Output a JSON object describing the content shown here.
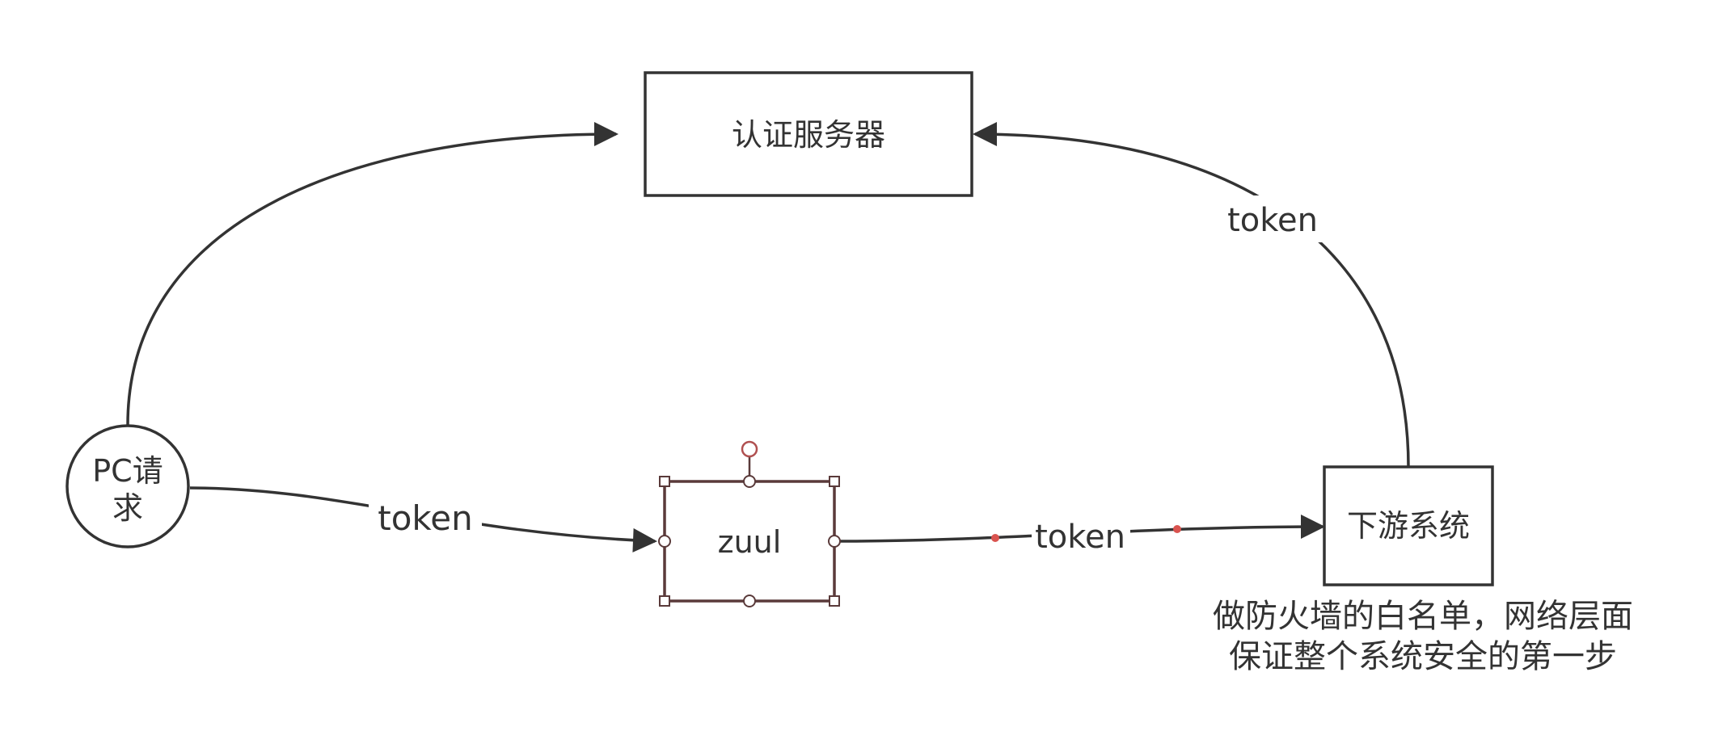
{
  "nodes": {
    "auth_server": "认证服务器",
    "pc_request_line1": "PC请",
    "pc_request_line2": "求",
    "zuul": "zuul",
    "downstream": "下游系统"
  },
  "edges": {
    "pc_to_zuul": "token",
    "zuul_to_downstream": "token",
    "downstream_to_auth": "token"
  },
  "note": "做防火墙的白名单，网络层面保证整个系统安全的第一步",
  "colors": {
    "stroke": "#333333",
    "selection": "#5a3a3a",
    "handle_red": "#d9534f"
  }
}
